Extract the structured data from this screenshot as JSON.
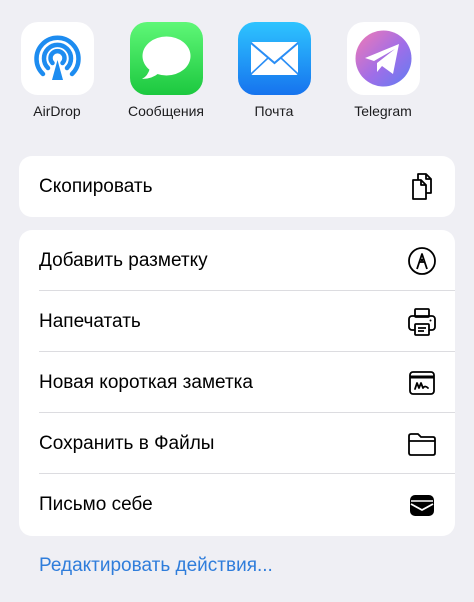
{
  "apps": [
    {
      "label": "AirDrop",
      "icon": "airdrop-icon"
    },
    {
      "label": "Сообщения",
      "icon": "messages-icon"
    },
    {
      "label": "Почта",
      "icon": "mail-icon"
    },
    {
      "label": "Telegram",
      "icon": "telegram-icon"
    }
  ],
  "actions_primary": [
    {
      "label": "Скопировать",
      "icon": "copy-icon"
    }
  ],
  "actions_secondary": [
    {
      "label": "Добавить разметку",
      "icon": "markup-icon"
    },
    {
      "label": "Напечатать",
      "icon": "printer-icon"
    },
    {
      "label": "Новая короткая заметка",
      "icon": "quick-note-icon"
    },
    {
      "label": "Сохранить в Файлы",
      "icon": "folder-icon"
    },
    {
      "label": "Письмо себе",
      "icon": "mail-self-icon"
    }
  ],
  "edit_actions_label": "Редактировать действия...",
  "colors": {
    "background": "#efeff4",
    "link": "#2f7ddb",
    "messages_green": "#1cc83f",
    "mail_blue": "#1673ee",
    "airdrop_blue": "#1d8cf0"
  }
}
